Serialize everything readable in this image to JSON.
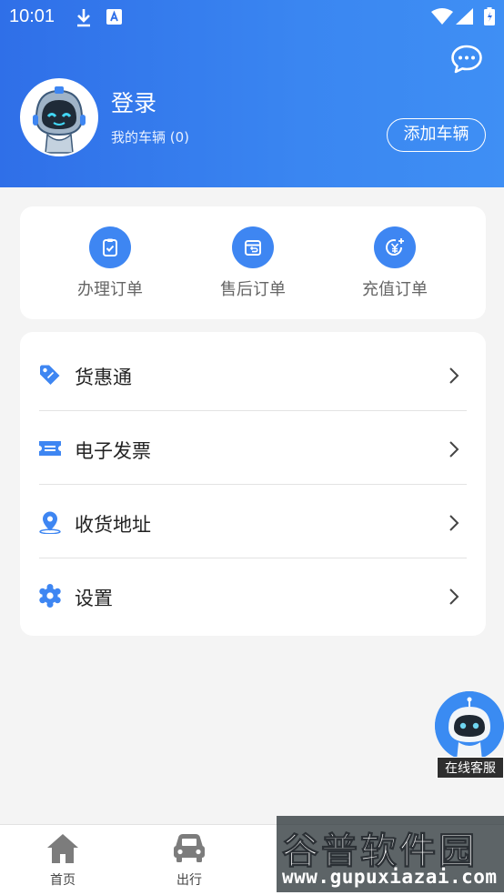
{
  "status_bar": {
    "time": "10:01"
  },
  "profile": {
    "login_label": "登录",
    "my_vehicles_label": "我的车辆 (0)",
    "add_vehicle_label": "添加车辆"
  },
  "orders": [
    {
      "label": "办理订单",
      "icon": "clipboard-check-icon"
    },
    {
      "label": "售后订单",
      "icon": "box-return-icon"
    },
    {
      "label": "充值订单",
      "icon": "yuan-recharge-icon"
    }
  ],
  "menu": [
    {
      "label": "货惠通",
      "icon": "tag-icon"
    },
    {
      "label": "电子发票",
      "icon": "ticket-icon"
    },
    {
      "label": "收货地址",
      "icon": "location-pin-icon"
    },
    {
      "label": "设置",
      "icon": "gear-icon"
    }
  ],
  "service": {
    "label": "在线客服"
  },
  "bottom_nav": [
    {
      "label": "首页",
      "icon": "home-icon"
    },
    {
      "label": "出行",
      "icon": "car-icon"
    }
  ],
  "watermark": {
    "title": "谷普软件园",
    "url": "www.gupuxiazai.com"
  },
  "colors": {
    "primary": "#3a86f1",
    "accent_icon": "#3e86f2",
    "background": "#f4f4f4"
  }
}
